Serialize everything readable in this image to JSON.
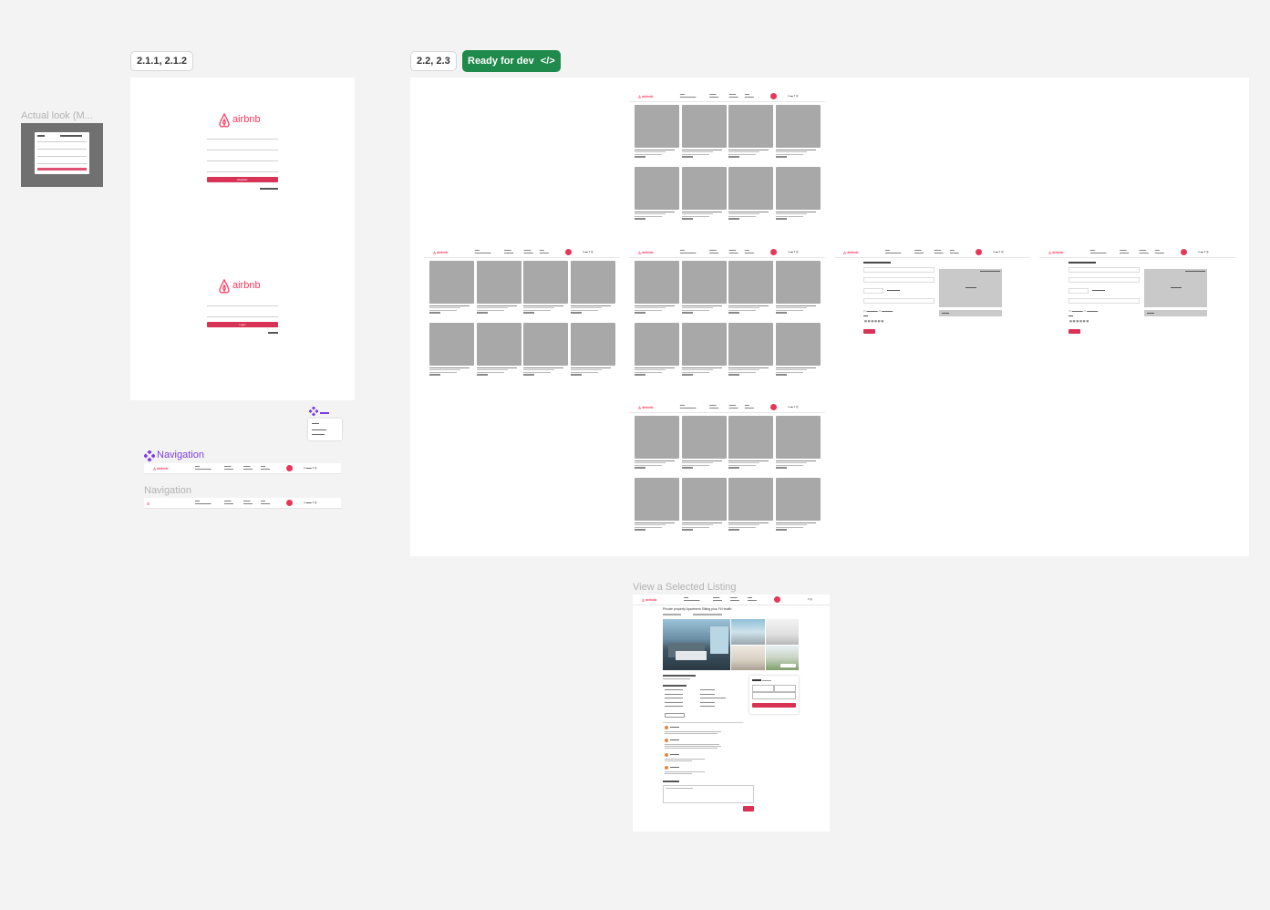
{
  "canvas": {
    "actual_look_label": "Actual look (M...",
    "frame_tag_login": "2.1.1, 2.1.2",
    "frame_tag_listings": "2.2, 2.3",
    "ready_for_dev": "Ready for dev",
    "navigation_component_label": "Navigation",
    "navigation_instance_label": "Navigation",
    "view_listing_label": "View a Selected Listing",
    "colors": {
      "brand": "#ff385c",
      "button": "#d83355",
      "ready": "#1f8a4c",
      "component": "#7b3fe4"
    }
  },
  "login": {
    "logo_text": "airbnb",
    "register_button": "Register",
    "login_button": "Login"
  },
  "listing_view": {
    "title": "Private property Apartment Sitting plus Fil Health"
  },
  "icons": [
    "airbnb-logo-icon",
    "component-diamond-icon",
    "code-icon",
    "search-icon",
    "user-avatar-icon"
  ]
}
